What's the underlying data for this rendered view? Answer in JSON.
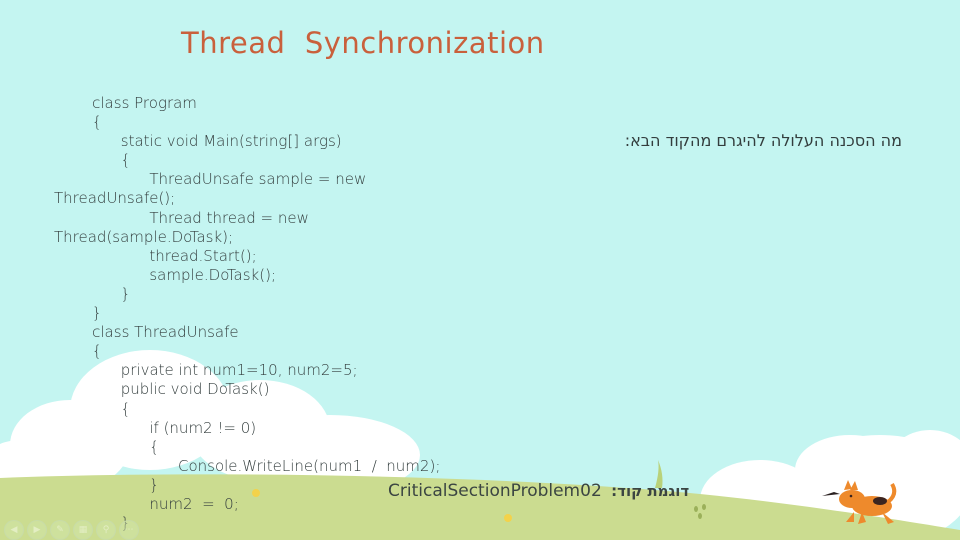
{
  "slide": {
    "title": "Thread  Synchronization",
    "question": "מה הסכנה העלולה להיגרם מהקוד הבא:",
    "code_lines": [
      "        class Program",
      "        {",
      "              static void Main(string[] args)",
      "              {",
      "                    ThreadUnsafe sample = new",
      "ThreadUnsafe();",
      "                    Thread thread = new",
      "Thread(sample.DoTask);",
      "                    thread.Start();",
      "                    sample.DoTask();",
      "              }",
      "        }",
      "        class ThreadUnsafe",
      "        {",
      "              private int num1=10, num2=5;",
      "              public void DoTask()",
      "              {",
      "                    if (num2 != 0)",
      "                    {",
      "                          Console.WriteLine(num1  /  num2);",
      "                    }",
      "                    num2  =  0;",
      "              }"
    ],
    "example_name": "CriticalSectionProblem02",
    "example_label": "דוגמת קוד:"
  },
  "nav_controls": [
    {
      "icon": "previous-icon",
      "glyph": "◀"
    },
    {
      "icon": "next-icon",
      "glyph": "▶"
    },
    {
      "icon": "pen-icon",
      "glyph": "✎"
    },
    {
      "icon": "slides-icon",
      "glyph": "▦"
    },
    {
      "icon": "zoom-icon",
      "glyph": "⚲"
    },
    {
      "icon": "more-icon",
      "glyph": "⋯"
    }
  ],
  "colors": {
    "sky": "#c4f5f1",
    "grass": "#cbdc90",
    "cloud": "#ffffff",
    "title": "#c9603c",
    "dog": "#ee8a2c"
  }
}
